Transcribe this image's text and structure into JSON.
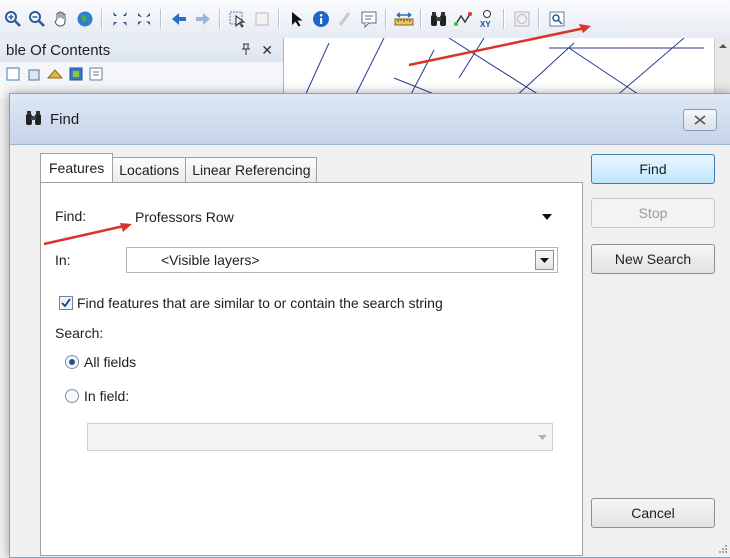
{
  "toolbar": {
    "icons": [
      "zoom-in-icon",
      "zoom-out-icon",
      "pan-icon",
      "full-extent-icon",
      "fixed-zoom-in-icon",
      "fixed-zoom-out-icon",
      "back-extent-icon",
      "forward-extent-icon",
      "select-features-icon",
      "clear-selection-icon",
      "select-elements-icon",
      "identify-icon",
      "hyperlink-icon",
      "html-popup-icon",
      "measure-icon",
      "find-icon",
      "find-route-icon",
      "go-to-xy-icon",
      "time-slider-icon",
      "viewer-icon"
    ]
  },
  "toc": {
    "title": "ble Of Contents",
    "pin_glyph": "4",
    "close_glyph": "✕"
  },
  "dialog": {
    "title": "Find",
    "tabs": [
      "Features",
      "Locations",
      "Linear Referencing"
    ],
    "find_label": "Find:",
    "find_value": "Professors Row",
    "in_label": "In:",
    "in_value": "<Visible layers>",
    "similar_checkbox_label": "Find features that are similar to or contain the search string",
    "search_label": "Search:",
    "all_fields_label": "All fields",
    "in_field_label": "In field:",
    "in_field_value": "",
    "buttons": {
      "find": "Find",
      "stop": "Stop",
      "new_search": "New Search",
      "cancel": "Cancel"
    }
  },
  "colors": {
    "annotation_arrow": "#d9352b",
    "accent_button": "#bee6fd",
    "titlebar": "#cfdcee"
  }
}
